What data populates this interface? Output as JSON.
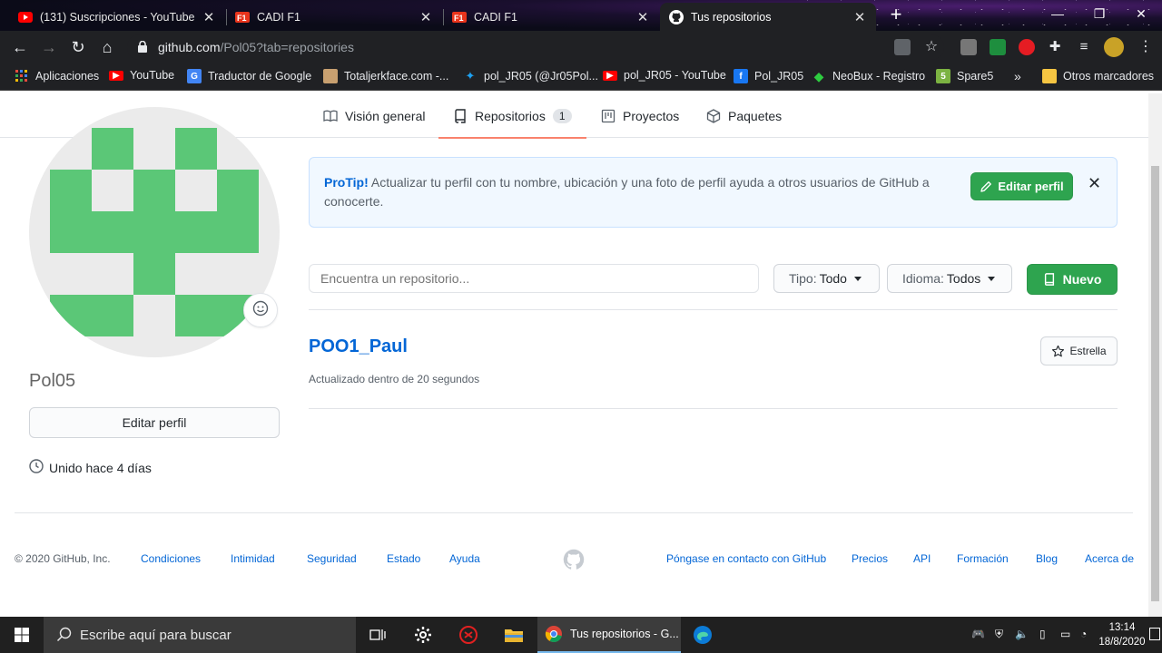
{
  "browser": {
    "tabs": [
      {
        "title": "(131) Suscripciones - YouTube",
        "icon": "youtube-icon"
      },
      {
        "title": "CADI F1",
        "icon": "f1-icon"
      },
      {
        "title": "CADI F1",
        "icon": "f1-icon"
      },
      {
        "title": "Tus repositorios",
        "icon": "github-icon"
      }
    ],
    "url_host": "github.com",
    "url_path": "/Pol05?tab=repositories",
    "bookmarks": [
      {
        "label": "Aplicaciones",
        "icon": "apps-grid-icon"
      },
      {
        "label": "YouTube",
        "icon": "youtube-icon"
      },
      {
        "label": "Traductor de Google",
        "icon": "google-translate-icon"
      },
      {
        "label": "Totaljerkface.com -...",
        "icon": "totaljerkface-icon"
      },
      {
        "label": "pol_JR05 (@Jr05Pol...",
        "icon": "twitter-icon"
      },
      {
        "label": "pol_JR05 - YouTube",
        "icon": "youtube-icon"
      },
      {
        "label": "Pol_JR05",
        "icon": "facebook-icon"
      },
      {
        "label": "NeoBux - Registro",
        "icon": "neobux-icon"
      },
      {
        "label": "Spare5",
        "icon": "spare5-icon"
      },
      {
        "label": "Otros marcadores",
        "icon": "folder-icon"
      }
    ],
    "overflow_label": "»"
  },
  "nav": {
    "tabs": [
      {
        "label": "Visión general",
        "icon": "book-icon"
      },
      {
        "label": "Repositorios",
        "icon": "repo-icon",
        "count": "1"
      },
      {
        "label": "Proyectos",
        "icon": "project-icon"
      },
      {
        "label": "Paquetes",
        "icon": "package-icon"
      }
    ]
  },
  "profile": {
    "username": "Pol05",
    "edit_label": "Editar perfil",
    "joined": "Unido hace 4 días",
    "avatar_color": "#5bc777"
  },
  "protip": {
    "lead": "ProTip!",
    "text": " Actualizar tu perfil con tu nombre, ubicación y una foto de perfil ayuda a otros usuarios de GitHub a conocerte.",
    "button": "Editar perfil",
    "close": "✕"
  },
  "filters": {
    "search_placeholder": "Encuentra un repositorio...",
    "type_label": "Tipo:",
    "type_value": "Todo",
    "lang_label": "Idioma:",
    "lang_value": "Todos",
    "new_label": "Nuevo"
  },
  "repos": [
    {
      "name": "POO1_Paul",
      "updated": "Actualizado dentro de 20 segundos",
      "star_label": "Estrella"
    }
  ],
  "footer": {
    "copyright": "© 2020 GitHub, Inc.",
    "links_left": [
      "Condiciones",
      "Intimidad",
      "Seguridad",
      "Estado",
      "Ayuda"
    ],
    "links_right": [
      "Póngase en contacto con GitHub",
      "Precios",
      "API",
      "Formación",
      "Blog",
      "Acerca de"
    ]
  },
  "taskbar": {
    "search_placeholder": "Escribe aquí para buscar",
    "active_app": "Tus repositorios - G...",
    "time": "13:14",
    "date": "18/8/2020"
  },
  "colors": {
    "accent_green": "#2ea44f",
    "link_blue": "#0366d6",
    "tab_underline": "#f9826c"
  }
}
